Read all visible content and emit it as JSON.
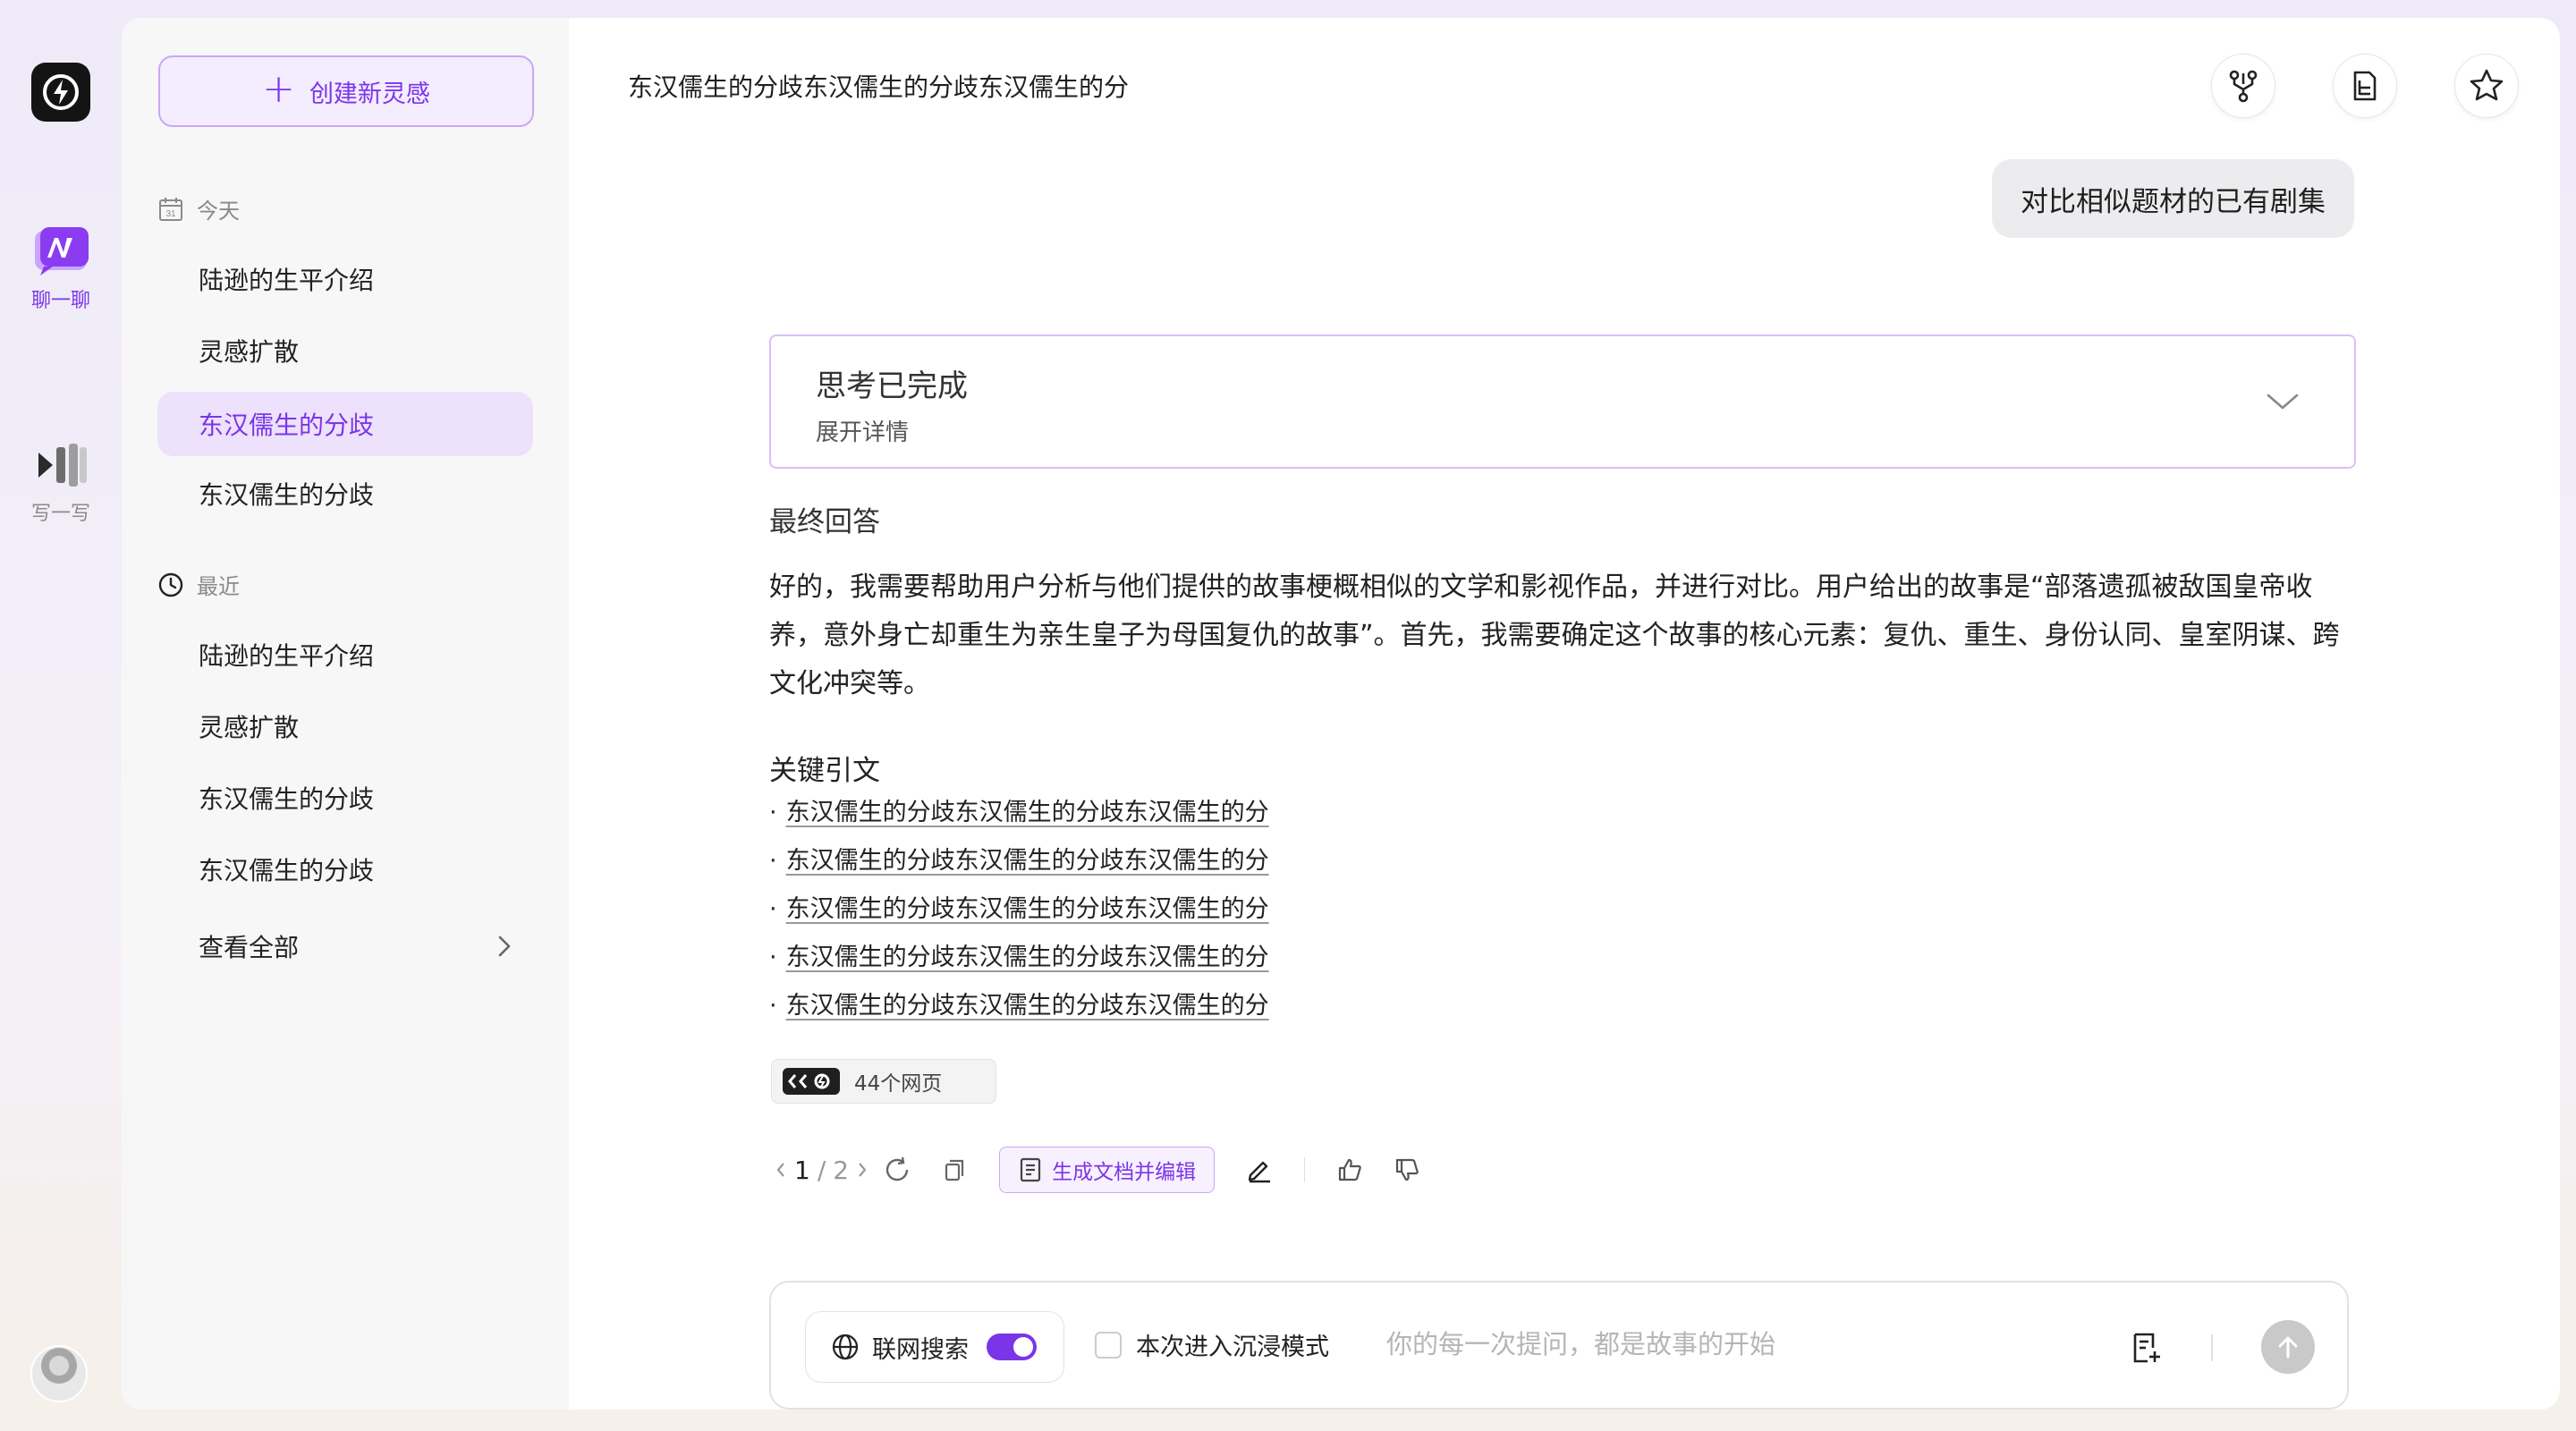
{
  "rail": {
    "logo_icon": "app-logo",
    "chat_label": "聊一聊",
    "write_label": "写一写",
    "accent": "#7b35e8"
  },
  "sidebar": {
    "new_button_label": "创建新灵感",
    "today_label": "今天",
    "today_items": [
      {
        "label": "陆逊的生平介绍",
        "active": false
      },
      {
        "label": "灵感扩散",
        "active": false
      },
      {
        "label": "东汉儒生的分歧",
        "active": true
      },
      {
        "label": "东汉儒生的分歧",
        "active": false
      }
    ],
    "recent_label": "最近",
    "recent_items": [
      {
        "label": "陆逊的生平介绍"
      },
      {
        "label": "灵感扩散"
      },
      {
        "label": "东汉儒生的分歧"
      },
      {
        "label": "东汉儒生的分歧"
      }
    ],
    "view_all_label": "查看全部"
  },
  "main": {
    "title": "东汉儒生的分歧东汉儒生的分歧东汉儒生的分",
    "top_icons": [
      "branch-icon",
      "document-icon",
      "star-icon"
    ],
    "user_message": "对比相似题材的已有剧集",
    "thinking": {
      "title": "思考已完成",
      "subtitle": "展开详情"
    },
    "final_label": "最终回答",
    "answer": "好的，我需要帮助用户分析与他们提供的故事梗概相似的文学和影视作品，并进行对比。用户给出的故事是“部落遗孤被敌国皇帝收养，意外身亡却重生为亲生皇子为母国复仇的故事”。首先，我需要确定这个故事的核心元素：复仇、重生、身份认同、皇室阴谋、跨文化冲突等。",
    "key_refs_label": "关键引文",
    "refs": [
      "东汉儒生的分歧东汉儒生的分歧东汉儒生的分",
      "东汉儒生的分歧东汉儒生的分歧东汉儒生的分",
      "东汉儒生的分歧东汉儒生的分歧东汉儒生的分",
      "东汉儒生的分歧东汉儒生的分歧东汉儒生的分",
      "东汉儒生的分歧东汉儒生的分歧东汉儒生的分"
    ],
    "ref_bullet": "·",
    "web_chip_label": "44个网页",
    "pager": {
      "current": "1",
      "separator": "/",
      "total": "2"
    },
    "generate_label": "生成文档并编辑"
  },
  "composer": {
    "web_search_label": "联网搜索",
    "web_search_on": true,
    "immersive_label": "本次进入沉浸模式",
    "placeholder": "你的每一次提问，都是故事的开始"
  }
}
